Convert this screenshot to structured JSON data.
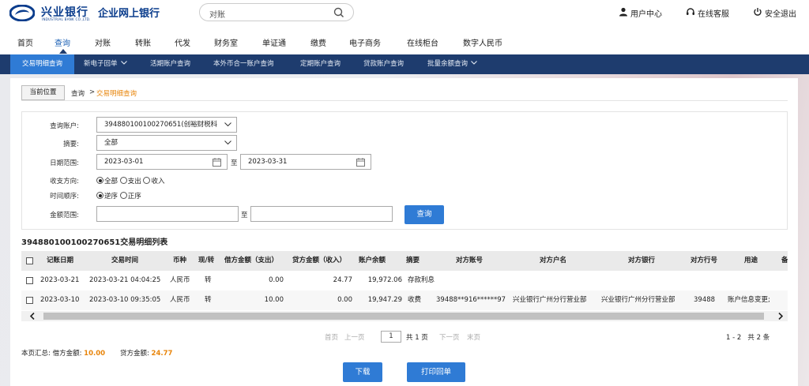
{
  "header": {
    "logo_cn": "兴业银行",
    "logo_en": "INDUSTRIAL BANK CO.,LTD.",
    "logo_sub": "企业网上银行",
    "search": {
      "value": "对账",
      "icon": "search-icon"
    },
    "links": [
      {
        "label": "用户中心",
        "icon": "user-icon"
      },
      {
        "label": "在线客服",
        "icon": "headset-icon"
      },
      {
        "label": "安全退出",
        "icon": "power-icon"
      }
    ]
  },
  "main_nav": [
    "首页",
    "查询",
    "对账",
    "转账",
    "代发",
    "财务室",
    "单证通",
    "缴费",
    "电子商务",
    "在线柜台",
    "数字人民币"
  ],
  "main_nav_active": "查询",
  "sub_nav": [
    "交易明细查询",
    "新电子回单",
    "活期账户查询",
    "本外币合一账户查询",
    "定期账户查询",
    "贷款账户查询",
    "批量余额查询"
  ],
  "sub_nav_active": "交易明细查询",
  "breadcrumb": {
    "current_label": "当前位置",
    "parent": "查询",
    "separator": ">",
    "page": "交易明细查询"
  },
  "form": {
    "account_label": "查询账户:",
    "account_value": "394880100100270651(创裕财税科",
    "summary_label": "摘要:",
    "summary_value": "全部",
    "date_label": "日期范围:",
    "date_from": "2023-03-01",
    "date_to_label": "至",
    "date_to": "2023-03-31",
    "direction_label": "收支方向:",
    "direction_options": [
      "全部",
      "支出",
      "收入"
    ],
    "direction_selected": "全部",
    "order_label": "时间顺序:",
    "order_options": [
      "逆序",
      "正序"
    ],
    "order_selected": "逆序",
    "amount_label": "金额范围:",
    "amount_to_label": "至",
    "amount_from": "",
    "amount_to": "",
    "query_button": "查询"
  },
  "list_title": "394880100100270651交易明细列表",
  "table": {
    "headers": [
      "记账日期",
      "交易时间",
      "币种",
      "现/转",
      "借方金额（支出）",
      "贷方金额（收入）",
      "账户余额",
      "摘要",
      "对方账号",
      "对方户名",
      "对方银行",
      "对方行号",
      "用途",
      "备"
    ],
    "rows": [
      [
        "2023-03-21",
        "2023-03-21 04:04:25",
        "人民币",
        "转",
        "0.00",
        "24.77",
        "19,972.06",
        "存款利息",
        "",
        "",
        "",
        "",
        "",
        ""
      ],
      [
        "2023-03-10",
        "2023-03-10 09:35:05",
        "人民币",
        "转",
        "10.00",
        "0.00",
        "19,947.29",
        "收费",
        "39488**916******97",
        "兴业银行广州分行营业部",
        "兴业银行广州分行营业部",
        "39488",
        "账户信息变更;",
        ""
      ]
    ]
  },
  "pager": {
    "first": "首页",
    "prev": "上一页",
    "page_input": "1",
    "total_pages": "共 1 页",
    "next": "下一页",
    "last": "末页",
    "range": "1 - 2",
    "total": "共 2 条"
  },
  "summary": {
    "label": "本页汇总:",
    "debit_label": "借方金额:",
    "debit_value": "10.00",
    "credit_label": "贷方金额:",
    "credit_value": "24.77"
  },
  "actions": {
    "download": "下载",
    "print": "打印回单"
  },
  "colors": {
    "nav_dark": "#1e3c6e",
    "accent_blue": "#2f7bd5",
    "highlight_orange": "#e8850b",
    "brand_blue": "#0a3c8c"
  }
}
